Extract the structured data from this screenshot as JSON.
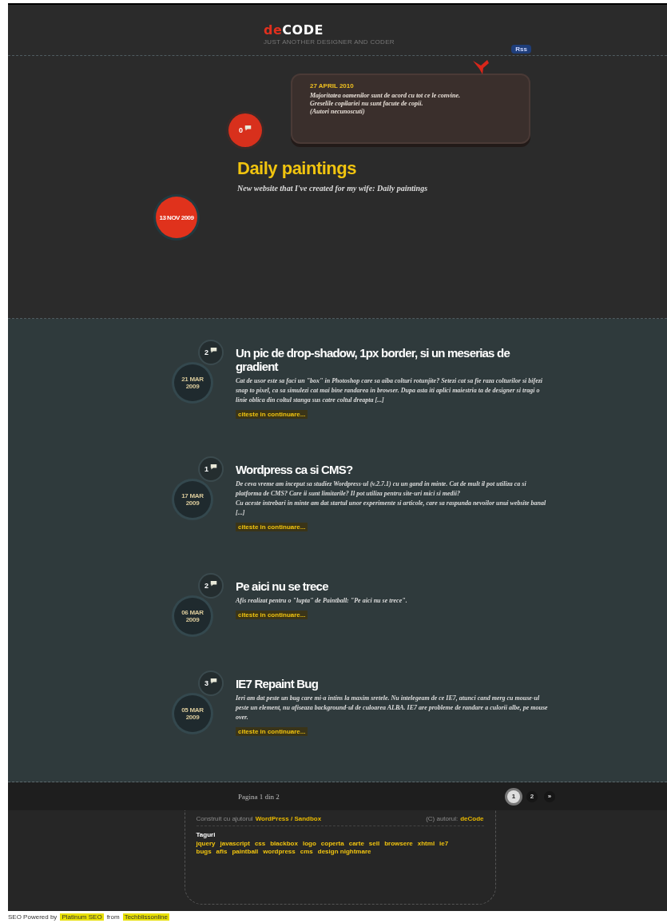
{
  "header": {
    "logo": {
      "accent": "de",
      "main": "CODE"
    },
    "tagline": "JUST ANOTHER DESIGNER AND CODER",
    "rss": "Rss"
  },
  "quote": {
    "date": "27 APRIL 2010",
    "lines": [
      "Majoritatea oamenilor sunt de acord cu tot ce le convine.",
      "Greselile copilariei nu sunt facute de copii.",
      "(Autori necunoscuti)"
    ]
  },
  "featured": {
    "comments": "0",
    "title": "Daily paintings",
    "excerpt": "New website that I've created for my wife: Daily paintings",
    "date": "13 NOV 2009"
  },
  "posts": [
    {
      "comments": "2",
      "day": "21 MAR",
      "year": "2009",
      "title": "Un pic de drop-shadow, 1px border, si un meserias de gradient",
      "excerpt": [
        "Cat de usor este sa faci un \"box\" in Photoshop care sa aiba colturi rotunjite? Setezi cat sa fie raza colturilor si bifezi snap to pixel, ca sa simulezi cat mai bine randarea in browser. Dupa asta iti aplici maiestria ta de designer si tragi o linie oblica din coltul stanga sus catre coltul dreapta [...]"
      ],
      "more": "citeste in continuare..."
    },
    {
      "comments": "1",
      "day": "17 MAR",
      "year": "2009",
      "title": "Wordpress ca si CMS?",
      "excerpt": [
        "De ceva vreme am inceput sa studiez Wordpress-ul (v.2.7.1) cu un gand in minte. Cat de mult il pot utiliza ca si platforma de CMS? Care ii sunt limitarile?  Il pot utiliza pentru site-uri mici si medii?",
        "Cu aceste intrebari in minte am dat startul unor experimente si articole, care sa raspunda nevoilor unui website banal [...]"
      ],
      "more": "citeste in continuare..."
    },
    {
      "comments": "2",
      "day": "06 MAR",
      "year": "2009",
      "title": "Pe aici nu se trece",
      "excerpt": [
        "Afis realizat pentru o \"lupta\" de Paintball: \"Pe aici nu se trece\"."
      ],
      "more": "citeste in continuare..."
    },
    {
      "comments": "3",
      "day": "05 MAR",
      "year": "2009",
      "title": "IE7 Repaint Bug",
      "excerpt": [
        "Ieri am dat peste un bug care mi-a intins la maxim sretele. Nu intelegeam de ce IE7, atunci cand merg cu mouse-ul peste un element, nu afiseaza background-ul de culoarea ALBA. IE7 are probleme de randare a culorii albe, pe mouse over."
      ],
      "more": "citeste in continuare..."
    }
  ],
  "pagination": {
    "label": "Pagina 1 din 2",
    "pages": [
      {
        "label": "1",
        "selected": true
      },
      {
        "label": "2",
        "selected": false
      },
      {
        "label": "»",
        "selected": false
      }
    ]
  },
  "footer": {
    "credit_text": "Construit cu ajutorul",
    "credit_link": "WordPress / Sandbox",
    "author_text": "(C) autorul:",
    "author_link": "deCode",
    "tags_title": "Taguri",
    "tags": [
      "jquery",
      "javascript",
      "css",
      "blackbox",
      "logo",
      "coperta",
      "carte",
      "sell",
      "browsere",
      "xhtml",
      "ie7",
      "bugs",
      "afis",
      "paintball",
      "wordpress",
      "cms",
      "design nightmare"
    ]
  },
  "bottom_bar": {
    "text1": "SEO Powered by",
    "link1": "Platinum SEO",
    "text2": "from",
    "link2": "Techblissonline"
  }
}
